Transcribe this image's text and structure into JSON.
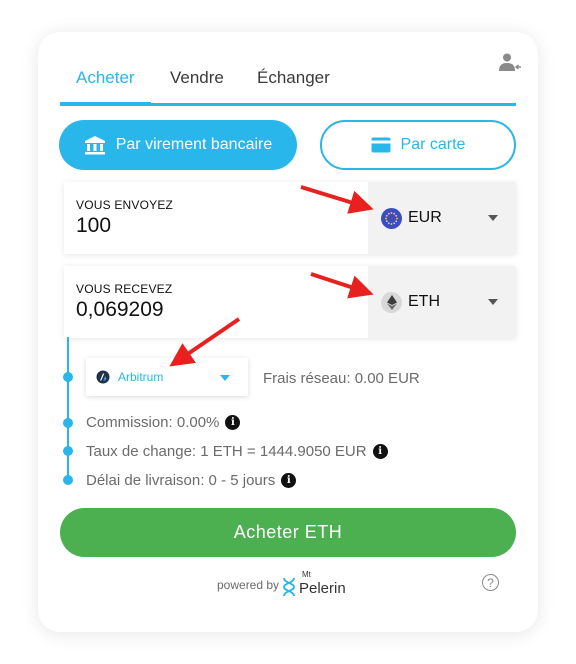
{
  "tabs": [
    {
      "label": "Acheter",
      "active": true
    },
    {
      "label": "Vendre",
      "active": false
    },
    {
      "label": "Échanger",
      "active": false
    }
  ],
  "header": {
    "user_icon": "user-switch-icon"
  },
  "payment_methods": {
    "bank": {
      "label": "Par virement bancaire",
      "icon": "bank-icon"
    },
    "card": {
      "label": "Par carte",
      "icon": "credit-card-icon"
    }
  },
  "send": {
    "label": "VOUS ENVOYEZ",
    "value": "100",
    "currency": "EUR",
    "icon": "eur-coin-icon"
  },
  "receive": {
    "label": "VOUS RECEVEZ",
    "value": "0,069209",
    "currency": "ETH",
    "icon": "eth-coin-icon"
  },
  "network": {
    "name": "Arbitrum",
    "fee_label": "Frais réseau: 0.00 EUR"
  },
  "details": [
    {
      "text": "Commission: 0.00%"
    },
    {
      "text": "Taux de change: 1 ETH = 1444.9050 EUR"
    },
    {
      "text": "Délai de livraison: 0 - 5 jours"
    }
  ],
  "cta": {
    "label": "Acheter ETH"
  },
  "footer": {
    "powered_by": "powered by",
    "brand_small": "Mt",
    "brand_name": "Pelerin",
    "help": "?"
  },
  "colors": {
    "accent": "#29b6ea",
    "cta": "#4caf50",
    "annotation_arrow": "#e8201e"
  }
}
